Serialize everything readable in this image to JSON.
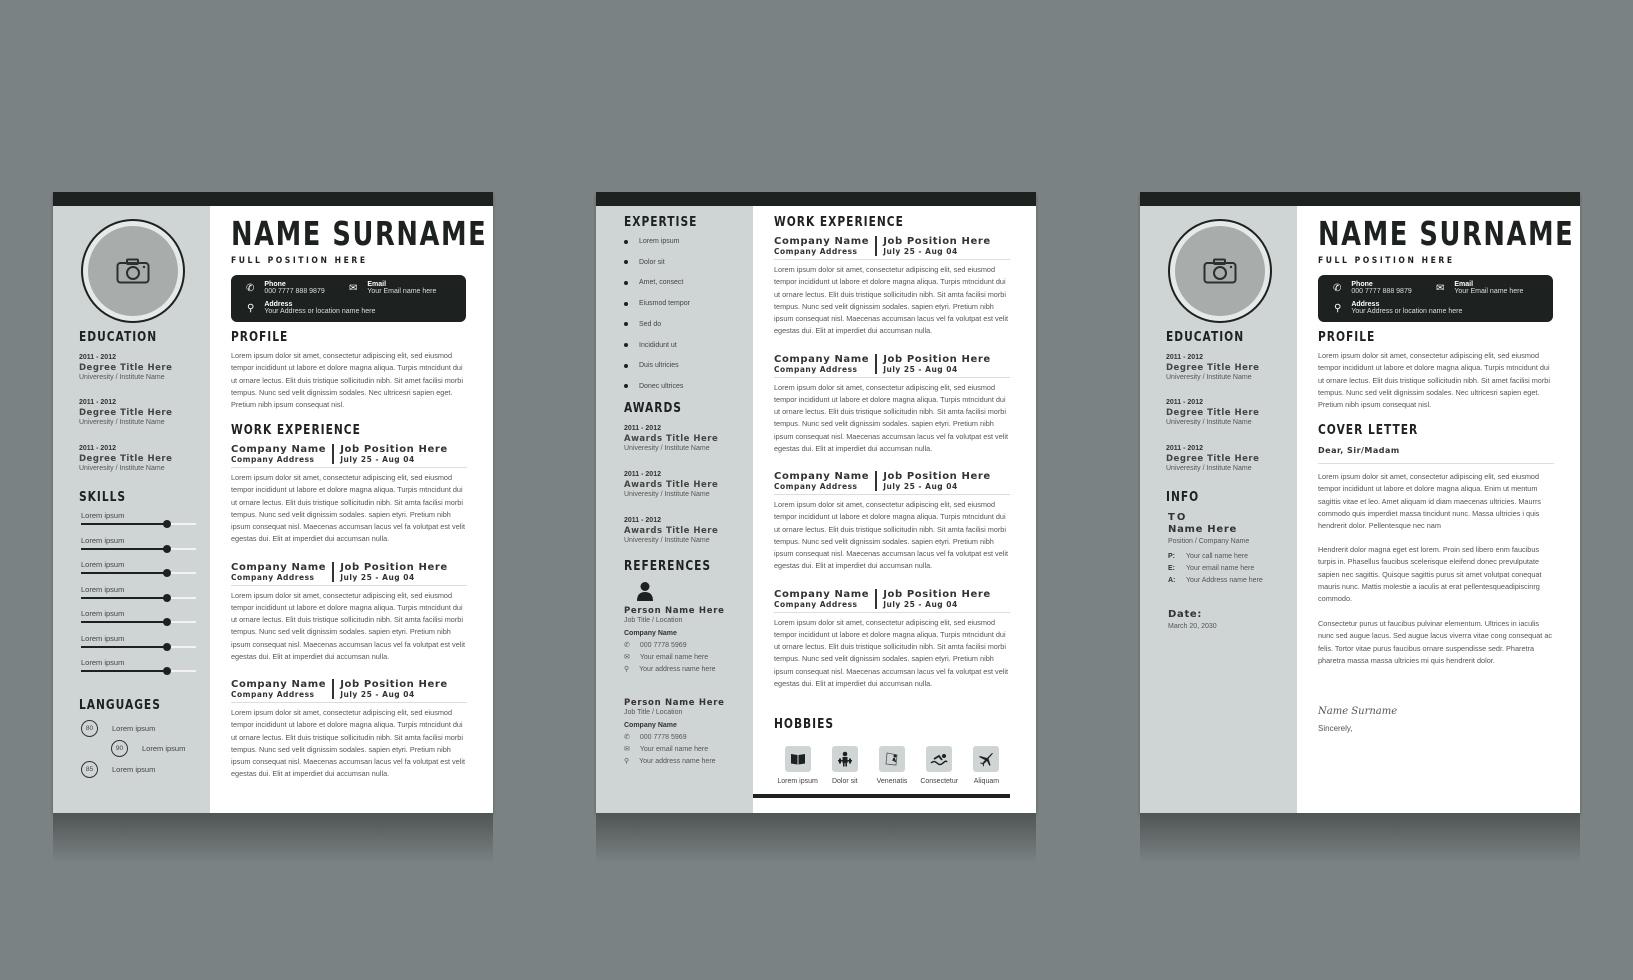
{
  "colors": {
    "background": "#7b8283",
    "dark": "#1d2221",
    "sidebar": "#cfd5d4",
    "photo": "#a8acab"
  },
  "resume_page": {
    "name": "NAME SURNAME",
    "position": "FULL POSITION HERE",
    "contact": {
      "phone_label": "Phone",
      "phone_value": "000 7777 888 9879",
      "email_label": "Email",
      "email_value": "Your Email name here",
      "address_label": "Address",
      "address_value": "Your Address or location name here"
    },
    "education": {
      "title": "EDUCATION",
      "items": [
        {
          "years": "2011 - 2012",
          "degree": "Degree Title Here",
          "school": "Univeresity / Institute Name"
        },
        {
          "years": "2011 - 2012",
          "degree": "Degree Title Here",
          "school": "Univeresity / Institute Name"
        },
        {
          "years": "2011 - 2012",
          "degree": "Degree Title Here",
          "school": "Univeresity / Institute Name"
        }
      ]
    },
    "skills": {
      "title": "SKILLS",
      "items": [
        {
          "label": "Lorem ipsum",
          "level": 0.75
        },
        {
          "label": "Lorem ipsum",
          "level": 0.75
        },
        {
          "label": "Lorem ipsum",
          "level": 0.75
        },
        {
          "label": "Lorem ipsum",
          "level": 0.75
        },
        {
          "label": "Lorem ipsum",
          "level": 0.75
        },
        {
          "label": "Lorem ipsum",
          "level": 0.75
        },
        {
          "label": "Lorem ipsum",
          "level": 0.75
        }
      ]
    },
    "languages": {
      "title": "LANGUAGES",
      "items": [
        {
          "score": "80",
          "label": "Lorem ipsum"
        },
        {
          "score": "90",
          "label": "Lorem ipsum"
        },
        {
          "score": "85",
          "label": "Lorem ipsum"
        }
      ]
    },
    "profile": {
      "title": "PROFILE",
      "text": "Lorem ipsum dolor sit amet, consectetur adipiscing elit, sed eiusmod tempor incididunt ut labore et dolore magna aliqua. Turpis mtncidunt dui ut ornare lectus. Elit duis tristique sollicitudin nibh. Sit amet facilisi morbi tempus. Nunc sed velit dignissim sodales. Nec ultricesri sapien eget. Pretium nibh ipsum consequat nisl."
    },
    "work": {
      "title": "WORK EXPERIENCE",
      "items": [
        {
          "company": "Company Name",
          "address": "Company Address",
          "job": "Job Position Here",
          "dates": "July 25 - Aug 04",
          "text": "Lorem ipsum dolor sit amet, consectetur adipiscing elit, sed eiusmod tempor incididunt ut labore et dolore magna aliqua. Turpis mtncidunt dui ut ornare lectus. Elit duis tristique sollicitudin nibh. Sit amta facilisi morbi tempus. Nunc sed velit dignissim sodales. sapien etyri. Pretium nibh ipsum consequat nisl. Maecenas accumsan lacus vel fa volutpat est velit egestas dui. Elit at imperdiet dui accumsan nulla."
        },
        {
          "company": "Company Name",
          "address": "Company Address",
          "job": "Job Position Here",
          "dates": "July 25 - Aug 04",
          "text": "Lorem ipsum dolor sit amet, consectetur adipiscing elit, sed eiusmod tempor incididunt ut labore et dolore magna aliqua. Turpis mtncidunt dui ut ornare lectus. Elit duis tristique sollicitudin nibh. Sit amta facilisi morbi tempus. Nunc sed velit dignissim sodales. sapien etyri. Pretium nibh ipsum consequat nisl. Maecenas accumsan lacus vel fa volutpat est velit egestas dui. Elit at imperdiet dui accumsan nulla."
        },
        {
          "company": "Company Name",
          "address": "Company Address",
          "job": "Job Position Here",
          "dates": "July 25 - Aug 04",
          "text": "Lorem ipsum dolor sit amet, consectetur adipiscing elit, sed eiusmod tempor incididunt ut labore et dolore magna aliqua. Turpis mtncidunt dui ut ornare lectus. Elit duis tristique sollicitudin nibh. Sit amta facilisi morbi tempus. Nunc sed velit dignissim sodales. sapien etyri. Pretium nibh ipsum consequat nisl. Maecenas accumsan lacus vel fa volutpat est velit egestas dui. Elit at imperdiet dui accumsan nulla."
        }
      ]
    }
  },
  "second_page": {
    "expertise": {
      "title": "EXPERTISE",
      "items": [
        "Lorem ipsum",
        "Dolor sit",
        "Amet, consect",
        "Eiusmod tempor",
        "Sed do",
        "Incididunt ut",
        "Duis ultricies",
        "Donec ultrices"
      ]
    },
    "awards": {
      "title": "AWARDS",
      "items": [
        {
          "years": "2011 - 2012",
          "title": "Awards Title Here",
          "school": "Univeresity / Institute Name"
        },
        {
          "years": "2011 - 2012",
          "title": "Awards Title Here",
          "school": "Univeresity / Institute Name"
        },
        {
          "years": "2011 - 2012",
          "title": "Awards Title Here",
          "school": "Univeresity / Institute Name"
        }
      ]
    },
    "references": {
      "title": "REFERENCES",
      "items": [
        {
          "name": "Person Name Here",
          "role": "Job Title / Location",
          "company": "Company Name",
          "phone": "000 7778 5969",
          "email": "Your email name here",
          "address": "Your address name here"
        },
        {
          "name": "Person Name Here",
          "role": "Job Title / Location",
          "company": "Company Name",
          "phone": "000 7778 5969",
          "email": "Your email name here",
          "address": "Your address name here"
        }
      ]
    },
    "work": {
      "title": "WORK EXPERIENCE",
      "items": [
        {
          "company": "Company Name",
          "address": "Company Address",
          "job": "Job Position Here",
          "dates": "July 25 - Aug 04",
          "text": "Lorem ipsum dolor sit amet, consectetur adipiscing elit, sed eiusmod tempor incididunt ut labore et dolore magna aliqua. Turpis mtncidunt dui ut ornare lectus. Elit duis tristique sollicitudin nibh. Sit amta facilisi morbi tempus. Nunc sed velit dignissim sodales. sapien etyri. Pretium nibh ipsum consequat nisl. Maecenas accumsan lacus vel fa volutpat est velit egestas dui. Elit at imperdiet dui accumsan nulla."
        },
        {
          "company": "Company Name",
          "address": "Company Address",
          "job": "Job Position Here",
          "dates": "July 25 - Aug 04",
          "text": "Lorem ipsum dolor sit amet, consectetur adipiscing elit, sed eiusmod tempor incididunt ut labore et dolore magna aliqua. Turpis mtncidunt dui ut ornare lectus. Elit duis tristique sollicitudin nibh. Sit amta facilisi morbi tempus. Nunc sed velit dignissim sodales. sapien etyri. Pretium nibh ipsum consequat nisl. Maecenas accumsan lacus vel fa volutpat est velit egestas dui. Elit at imperdiet dui accumsan nulla."
        },
        {
          "company": "Company Name",
          "address": "Company Address",
          "job": "Job Position Here",
          "dates": "July 25 - Aug 04",
          "text": "Lorem ipsum dolor sit amet, consectetur adipiscing elit, sed eiusmod tempor incididunt ut labore et dolore magna aliqua. Turpis mtncidunt dui ut ornare lectus. Elit duis tristique sollicitudin nibh. Sit amta facilisi morbi tempus. Nunc sed velit dignissim sodales. sapien etyri. Pretium nibh ipsum consequat nisl. Maecenas accumsan lacus vel fa volutpat est velit egestas dui. Elit at imperdiet dui accumsan nulla."
        },
        {
          "company": "Company Name",
          "address": "Company Address",
          "job": "Job Position Here",
          "dates": "July 25 - Aug 04",
          "text": "Lorem ipsum dolor sit amet, consectetur adipiscing elit, sed eiusmod tempor incididunt ut labore et dolore magna aliqua. Turpis mtncidunt dui ut ornare lectus. Elit duis tristique sollicitudin nibh. Sit amta facilisi morbi tempus. Nunc sed velit dignissim sodales. sapien etyri. Pretium nibh ipsum consequat nisl. Maecenas accumsan lacus vel fa volutpat est velit egestas dui. Elit at imperdiet dui accumsan nulla."
        }
      ]
    },
    "hobbies": {
      "title": "HOBBIES",
      "items": [
        {
          "icon": "book-icon",
          "label": "Lorem ipsum"
        },
        {
          "icon": "weightlifting-icon",
          "label": "Dolor sit"
        },
        {
          "icon": "climbing-icon",
          "label": "Venenatis"
        },
        {
          "icon": "swimming-icon",
          "label": "Consectetur"
        },
        {
          "icon": "airplane-icon",
          "label": "Aliquam"
        }
      ]
    }
  },
  "cover_page": {
    "name": "NAME SURNAME",
    "position": "FULL POSITION HERE",
    "contact": {
      "phone_label": "Phone",
      "phone_value": "000 7777 888 9879",
      "email_label": "Email",
      "email_value": "Your Email name here",
      "address_label": "Address",
      "address_value": "Your Address or location name here"
    },
    "education": {
      "title": "EDUCATION",
      "items": [
        {
          "years": "2011 - 2012",
          "degree": "Degree Title Here",
          "school": "Univeresity / Institute Name"
        },
        {
          "years": "2011 - 2012",
          "degree": "Degree Title Here",
          "school": "Univeresity / Institute Name"
        },
        {
          "years": "2011 - 2012",
          "degree": "Degree Title Here",
          "school": "Univeresity / Institute Name"
        }
      ]
    },
    "info": {
      "title": "INFO",
      "to": "TO",
      "recipient": "Name Here",
      "recipient_role": "Position / Company Name",
      "rows": [
        {
          "key": "P:",
          "value": "Your  call name here"
        },
        {
          "key": "E:",
          "value": "Your  email name here"
        },
        {
          "key": "A:",
          "value": "Your  Address name here"
        }
      ],
      "date_label": "Date:",
      "date_value": "March 20, 2030"
    },
    "profile": {
      "title": "PROFILE",
      "text": "Lorem ipsum dolor sit amet, consectetur adipiscing elit, sed eiusmod tempor incididunt ut labore et dolore magna aliqua. Turpis mtncidunt dui ut ornare lectus. Elit duis tristique sollicitudin nibh. Sit amet facilisi morbi tempus. Nunc sed velit dignissim sodales. Nec ultricesri sapien eget. Pretium nibh ipsum consequat nisl."
    },
    "letter": {
      "title": "COVER LETTER",
      "greeting": "Dear, Sir/Madam",
      "paragraphs": [
        "Lorem ipsum dolor sit amet, consectetur adipiscing elit, sed eiusmod tempor incididunt ut labore et dolore magna aliqua. Enim ut mentum sagittis vitae et leo. Amet aliquam id diam maecenas ultricies. Maurrs commodo quis imperdiet massa tincidunt nunc. Massa ultricies i quis hendrerit dolor. Pellentesque nec nam",
        "Hendrerit dolor magna eget est lorem. Proin sed libero enm faucibus turpis in. Phasellus faucibus scelerisque eleifend donec prevulputate sapien nec sagittis. Quisque sagittis purus sit amet volutpat conequat mauris nunc. Mattis molestie a iaculis at erat pellentesqueadipiscinrg commodo.",
        "Consectetur purus ut faucibus pulvinar elementum. Ultrices in iaculis nunc sed augue lacus. Sed augue lacus viverra vitae cong consequat ac felis. Tortor vitae purus faucibus ornare suspendisse sedr. Pharetra pharetra massa massa ultricies mi quis hendrerit dolor."
      ],
      "signature": "Name Surname",
      "closing": "Sincerely,"
    }
  }
}
